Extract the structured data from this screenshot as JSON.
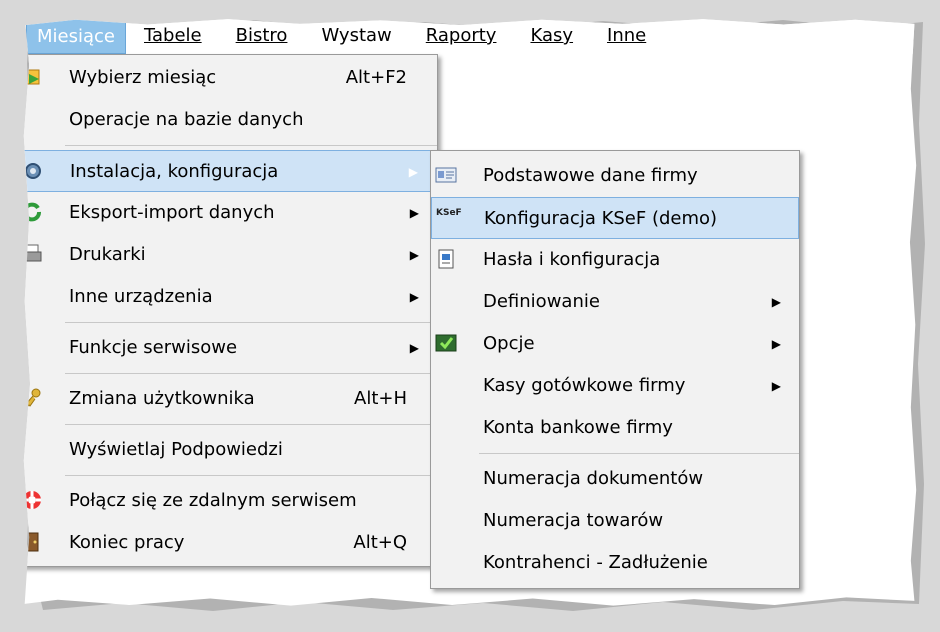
{
  "menubar": [
    {
      "label": "Miesiące",
      "active": true
    },
    {
      "label": "Tabele"
    },
    {
      "label": "Bistro"
    },
    {
      "label": "Wystaw"
    },
    {
      "label": "Raporty"
    },
    {
      "label": "Kasy"
    },
    {
      "label": "Inne"
    }
  ],
  "main_menu": {
    "items": [
      {
        "label": "Wybierz miesiąc",
        "shortcut": "Alt+F2",
        "icon": "calendar-arrow-icon"
      },
      {
        "label": "Operacje na bazie danych"
      },
      {
        "separator": true
      },
      {
        "label": "Instalacja, konfiguracja",
        "submenu": true,
        "highlighted": true,
        "icon": "gear-icon"
      },
      {
        "label": "Eksport-import danych",
        "submenu": true,
        "icon": "refresh-arrows-icon"
      },
      {
        "label": "Drukarki",
        "submenu": true,
        "icon": "printer-icon"
      },
      {
        "label": "Inne urządzenia",
        "submenu": true
      },
      {
        "separator": true
      },
      {
        "label": "Funkcje serwisowe",
        "submenu": true
      },
      {
        "separator": true
      },
      {
        "label": "Zmiana użytkownika",
        "shortcut": "Alt+H",
        "icon": "key-icon"
      },
      {
        "separator": true
      },
      {
        "label": "Wyświetlaj Podpowiedzi"
      },
      {
        "separator": true
      },
      {
        "label": "Połącz się ze zdalnym serwisem",
        "icon": "lifebuoy-icon"
      },
      {
        "label": "Koniec pracy",
        "shortcut": "Alt+Q",
        "icon": "exit-door-icon"
      }
    ]
  },
  "sub_menu": {
    "items": [
      {
        "label": "Podstawowe dane firmy",
        "icon": "company-card-icon"
      },
      {
        "label": "Konfiguracja KSeF (demo)",
        "highlighted": true,
        "icon": "ksef-logo-icon",
        "icon_text": "KSeF"
      },
      {
        "label": "Hasła i konfiguracja",
        "icon": "password-id-icon"
      },
      {
        "label": "Definiowanie",
        "submenu": true
      },
      {
        "label": "Opcje",
        "submenu": true,
        "icon": "checkbox-options-icon"
      },
      {
        "label": "Kasy gotówkowe firmy",
        "submenu": true
      },
      {
        "label": "Konta bankowe firmy"
      },
      {
        "separator": true
      },
      {
        "label": "Numeracja dokumentów"
      },
      {
        "label": "Numeracja towarów"
      },
      {
        "label": "Kontrahenci - Zadłużenie"
      }
    ]
  },
  "colors": {
    "menubar_active": "#8ec2ea",
    "highlight_bg": "#cfe3f6",
    "highlight_border": "#7eb0e0",
    "menu_bg": "#f2f2f2"
  }
}
